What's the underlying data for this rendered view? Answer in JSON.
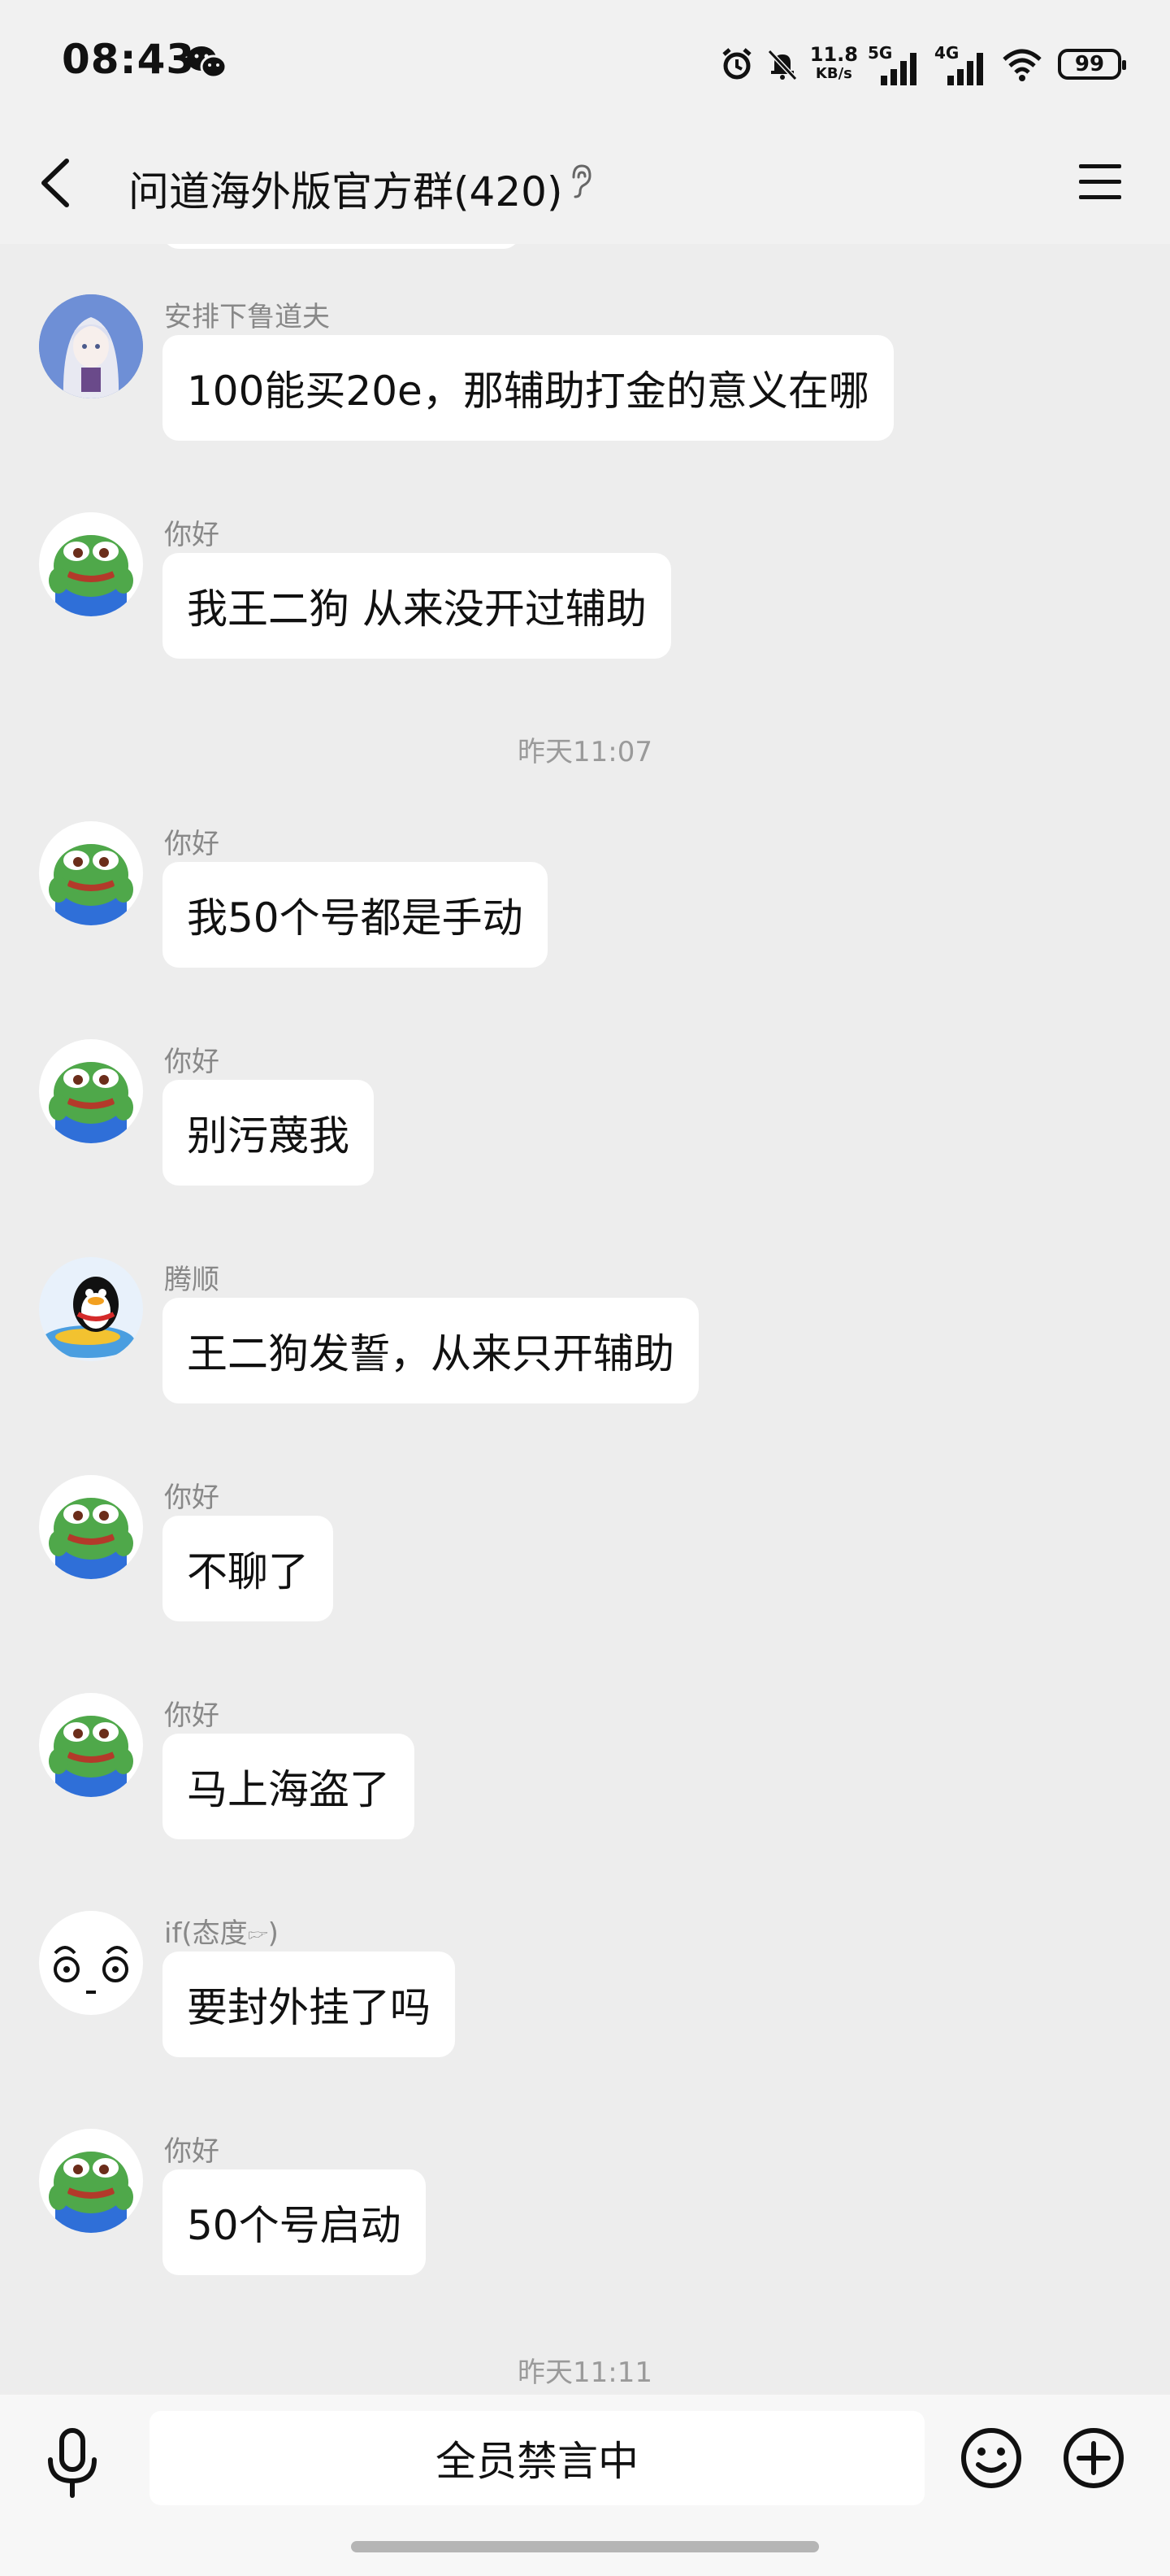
{
  "status_bar": {
    "time": "08:43",
    "speed_value": "11.8",
    "speed_unit": "KB/s",
    "net1_label": "5G",
    "net2_label": "4G",
    "battery": "99"
  },
  "header": {
    "title": "问道海外版官方群(420)"
  },
  "messages": [
    {
      "sender": "安排下鲁道夫",
      "text": "100能买20e，那辅助打金的意义在哪",
      "avatar": "anime-avatar"
    },
    {
      "sender": "你好",
      "text": "我王二狗 从来没开过辅助",
      "avatar": "frog-avatar"
    },
    {
      "sender": "你好",
      "text": "我50个号都是手动",
      "avatar": "frog-avatar"
    },
    {
      "sender": "你好",
      "text": "别污蔑我",
      "avatar": "frog-avatar"
    },
    {
      "sender": "腾顺",
      "text": "王二狗发誓，从来只开辅助",
      "avatar": "penguin-avatar"
    },
    {
      "sender": "你好",
      "text": "不聊了",
      "avatar": "frog-avatar"
    },
    {
      "sender": "你好",
      "text": "马上海盗了",
      "avatar": "frog-avatar"
    },
    {
      "sender": "if(态度🖙)",
      "text": "要封外挂了吗",
      "avatar": "face-avatar"
    },
    {
      "sender": "你好",
      "text": "50个号启动",
      "avatar": "frog-avatar"
    }
  ],
  "timestamps": [
    "昨天11:07",
    "昨天11:11"
  ],
  "input_bar": {
    "muted_text": "全员禁言中"
  },
  "colors": {
    "background": "#ededed",
    "bubble": "#ffffff",
    "sender_text": "#888888"
  }
}
